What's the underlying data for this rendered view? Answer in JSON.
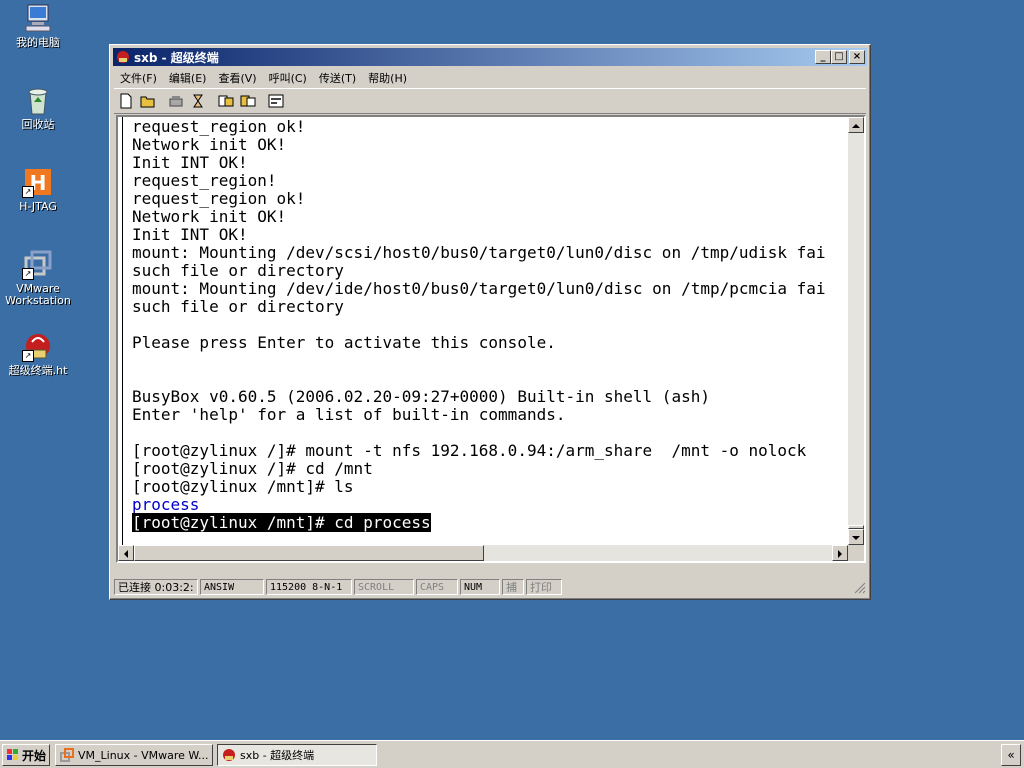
{
  "desktop": {
    "icons": [
      {
        "label": "我的电脑",
        "icon": "my-computer-icon"
      },
      {
        "label": "回收站",
        "icon": "recycle-bin-icon"
      },
      {
        "label": "H-JTAG",
        "icon": "hjtag-icon"
      },
      {
        "label": "VMware\nWorkstation",
        "icon": "vmware-icon"
      },
      {
        "label": "超级终端.ht",
        "icon": "hyperterminal-icon"
      }
    ]
  },
  "window": {
    "title": "sxb - 超级终端",
    "buttons": {
      "minimize": "_",
      "maximize": "□",
      "close": "×"
    },
    "menu": [
      "文件(F)",
      "编辑(E)",
      "查看(V)",
      "呼叫(C)",
      "传送(T)",
      "帮助(H)"
    ],
    "toolbar_icons": [
      "new-icon",
      "open-icon",
      "disconnect-icon",
      "properties-phone-icon",
      "send-icon",
      "receive-icon",
      "properties-icon"
    ]
  },
  "terminal": {
    "lines": [
      "request_region ok!",
      "Network init OK!",
      "Init INT OK!",
      "request_region!",
      "request_region ok!",
      "Network init OK!",
      "Init INT OK!",
      "mount: Mounting /dev/scsi/host0/bus0/target0/lun0/disc on /tmp/udisk fai",
      "such file or directory",
      "mount: Mounting /dev/ide/host0/bus0/target0/lun0/disc on /tmp/pcmcia fai",
      "such file or directory",
      "",
      "Please press Enter to activate this console.",
      "",
      "",
      "BusyBox v0.60.5 (2006.02.20-09:27+0000) Built-in shell (ash)",
      "Enter 'help' for a list of built-in commands.",
      "",
      "[root@zylinux /]# mount -t nfs 192.168.0.94:/arm_share  /mnt -o nolock",
      "[root@zylinux /]# cd /mnt",
      "[root@zylinux /mnt]# ls",
      "process",
      "[root@zylinux /mnt]# cd process"
    ],
    "highlight_blue_index": 21,
    "selected_index": 22
  },
  "statusbar": {
    "connected": "已连接 0:03:2:",
    "emulation": "ANSIW",
    "settings": "115200 8-N-1",
    "scroll": "SCROLL",
    "caps": "CAPS",
    "num": "NUM",
    "capture": "捕",
    "print": "打印"
  },
  "taskbar": {
    "start": "开始",
    "tasks": [
      "VM_Linux - VMware W...",
      "sxb - 超级终端"
    ],
    "tray": "«"
  }
}
